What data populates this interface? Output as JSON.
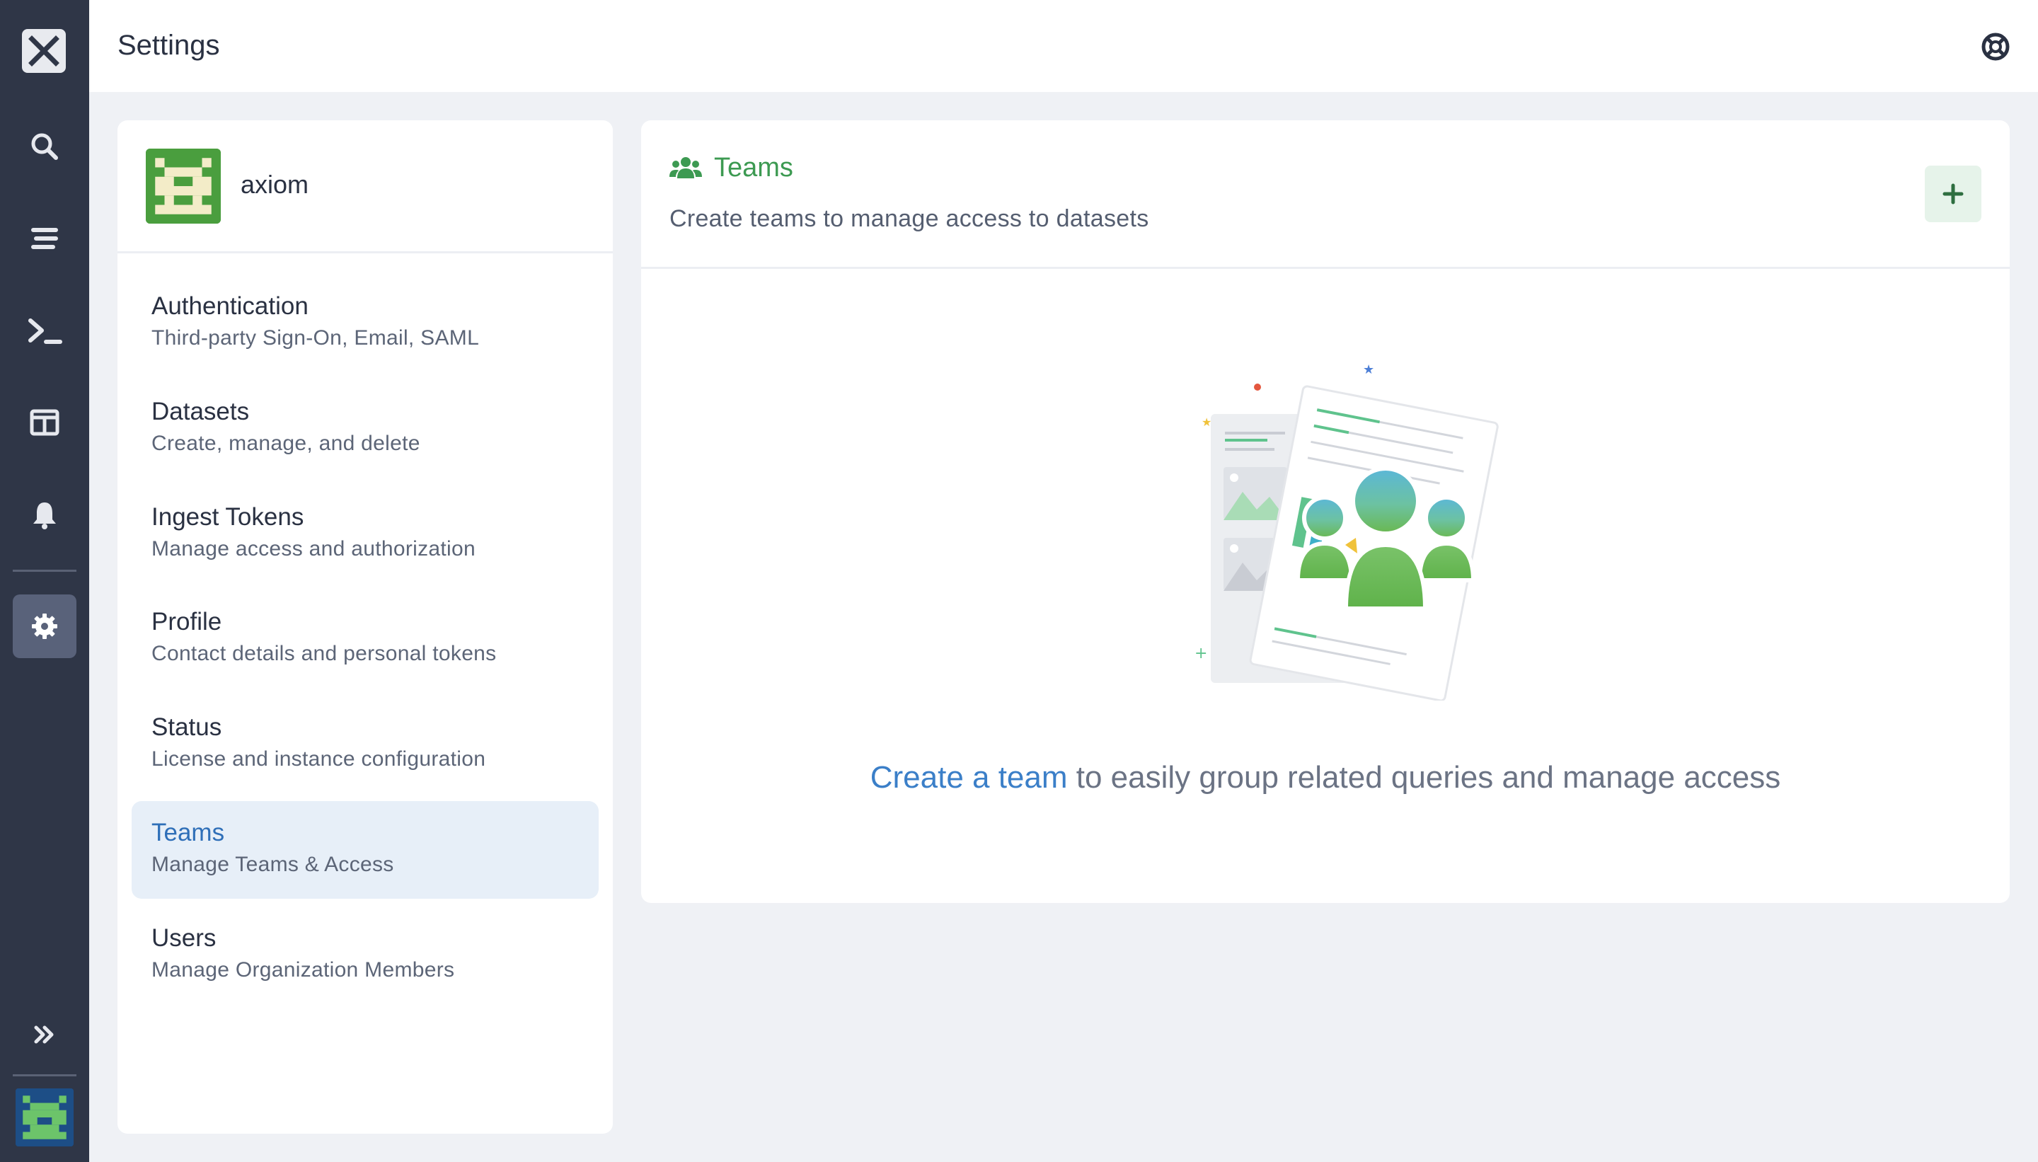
{
  "app": {
    "title": "Settings"
  },
  "org": {
    "name": "axiom"
  },
  "nav": [
    {
      "title": "Authentication",
      "subtitle": "Third-party Sign-On, Email, SAML"
    },
    {
      "title": "Datasets",
      "subtitle": "Create, manage, and delete"
    },
    {
      "title": "Ingest Tokens",
      "subtitle": "Manage access and authorization"
    },
    {
      "title": "Profile",
      "subtitle": "Contact details and personal tokens"
    },
    {
      "title": "Status",
      "subtitle": "License and instance configuration"
    },
    {
      "title": "Teams",
      "subtitle": "Manage Teams & Access",
      "active": true
    },
    {
      "title": "Users",
      "subtitle": "Manage Organization Members"
    }
  ],
  "panel": {
    "title": "Teams",
    "description": "Create teams to manage access to datasets",
    "add_label": "+",
    "cta_link": "Create a team",
    "cta_text": " to easily group related queries and manage access"
  },
  "rail": {
    "icons": [
      "close-logo-icon",
      "search-icon",
      "stream-icon",
      "terminal-icon",
      "dashboard-icon",
      "bell-icon",
      "gear-icon",
      "double-chevron-right-icon"
    ]
  },
  "colors": {
    "accent_green": "#3d9a52",
    "link_blue": "#3b7fc8",
    "rail_bg": "#2f3647",
    "active_nav_bg": "#e7eff8"
  }
}
